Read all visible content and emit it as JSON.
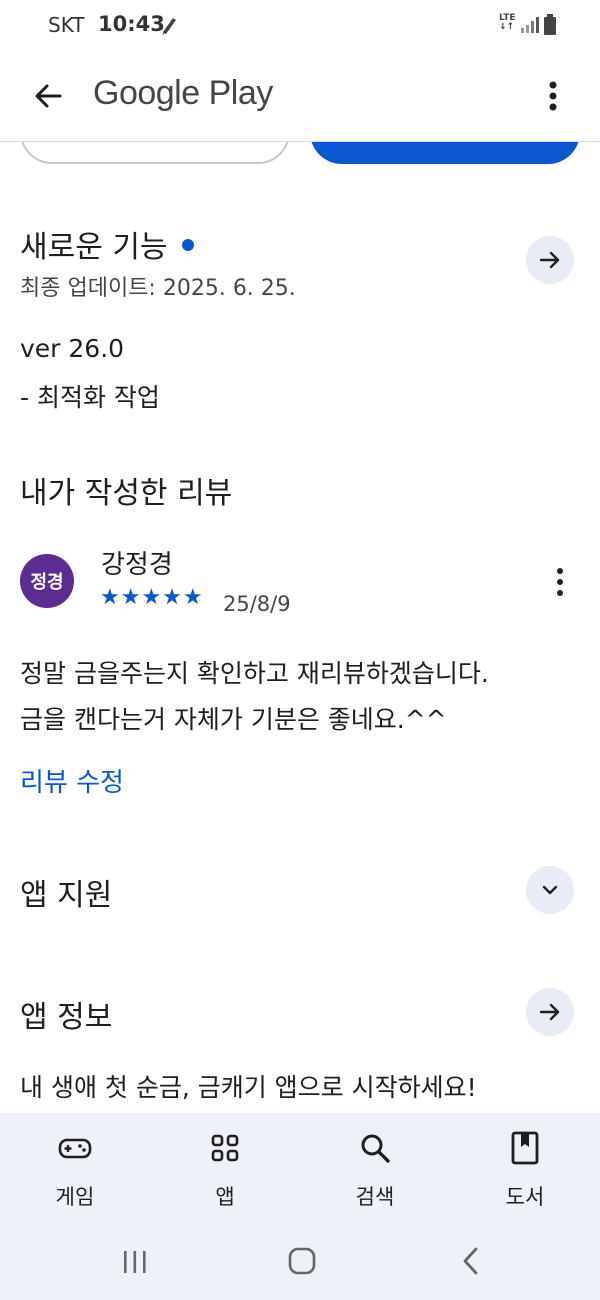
{
  "status_bar": {
    "carrier": "SKT",
    "time": "10:43",
    "network": "LTE"
  },
  "app_bar": {
    "title": "Google Play"
  },
  "whats_new": {
    "title": "새로운 기능",
    "updated": "최종 업데이트: 2025. 6. 25.",
    "version": "ver 26.0",
    "notes": "- 최적화 작업"
  },
  "my_review": {
    "title": "내가 작성한 리뷰",
    "avatar_text": "정경",
    "reviewer": "강정경",
    "stars": "★★★★★",
    "rating": 5,
    "date": "25/8/9",
    "text_line1": "정말 금을주는지 확인하고 재리뷰하겠습니다.",
    "text_line2": "금을 캔다는거 자체가 기분은 좋네요.^^",
    "edit_label": "리뷰 수정"
  },
  "app_support": {
    "title": "앱 지원"
  },
  "app_info": {
    "title": "앱 정보",
    "description": "내 생애 첫 순금, 금캐기 앱으로 시작하세요!"
  },
  "bottom_nav": [
    {
      "label": "게임",
      "icon": "gamepad-icon"
    },
    {
      "label": "앱",
      "icon": "apps-grid-icon"
    },
    {
      "label": "검색",
      "icon": "search-icon"
    },
    {
      "label": "도서",
      "icon": "book-icon"
    }
  ],
  "colors": {
    "accent": "#0b57d0",
    "avatar": "#5c2d91",
    "nav_bg": "#eef1f8"
  }
}
